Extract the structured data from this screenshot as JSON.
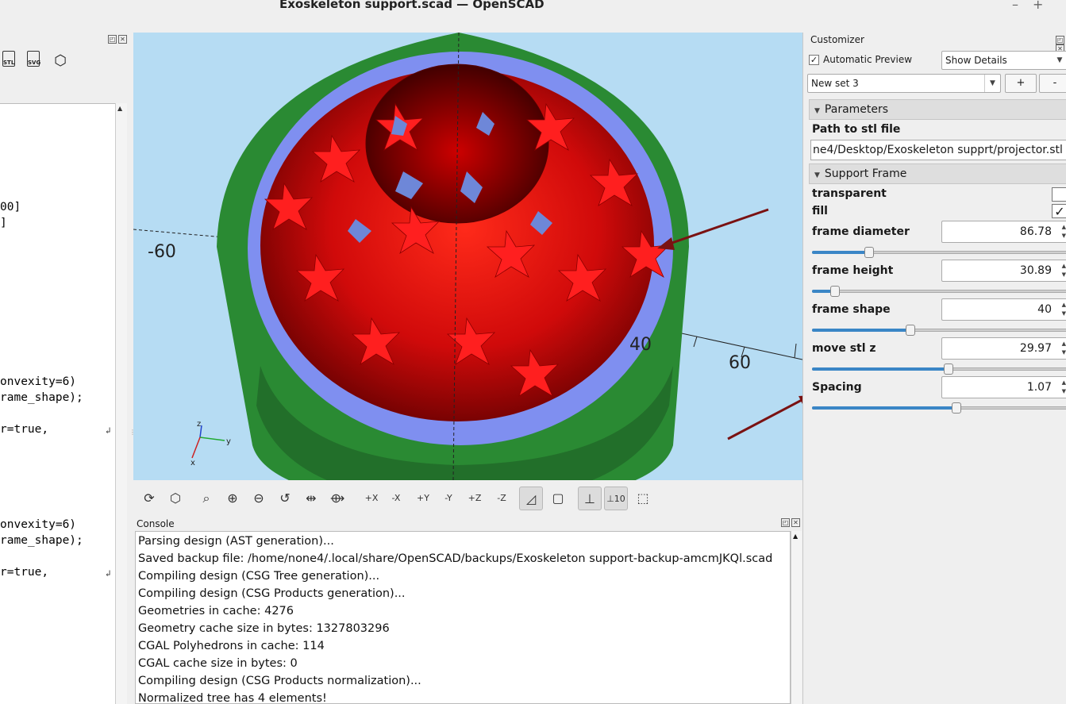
{
  "window": {
    "title": "Exoskeleton support.scad — OpenSCAD",
    "min_glyph": "–",
    "max_glyph": "+"
  },
  "editor": {
    "toolbar": [
      {
        "name": "export-stl-button",
        "label": "STL"
      },
      {
        "name": "export-svg-button",
        "label": "SVG"
      },
      {
        "name": "export-3d-button",
        "label": "⬡"
      }
    ],
    "lines": [
      {
        "text": "00]"
      },
      {
        "text": "]"
      },
      {
        "text": "onvexity=6)"
      },
      {
        "text": "rame_shape);"
      },
      {
        "text": "r=true,"
      },
      {
        "text": "onvexity=6)"
      },
      {
        "text": "rame_shape);"
      },
      {
        "text": "r=true,"
      }
    ],
    "wrap_glyph": "↲"
  },
  "viewport": {
    "axis_labels": [
      "-60",
      "40",
      "60"
    ],
    "gizmo_labels": {
      "z": "z",
      "y": "y",
      "x": "x"
    },
    "colors": {
      "background": "#b6dcf3",
      "frame_outer": "#2a8a33",
      "frame_inner": "#7f8ff0",
      "sphere": "#d70c0c",
      "arrow": "#7a1212"
    }
  },
  "view_toolbar": {
    "buttons": [
      {
        "name": "preview-button",
        "glyph": "⟳",
        "active": false
      },
      {
        "name": "render-button",
        "glyph": "⬡",
        "active": false
      },
      {
        "name": "view-all-button",
        "glyph": "⌕",
        "active": false
      },
      {
        "name": "zoom-in-button",
        "glyph": "⊕",
        "active": false
      },
      {
        "name": "zoom-out-button",
        "glyph": "⊖",
        "active": false
      },
      {
        "name": "reset-view-button",
        "glyph": "↺",
        "active": false
      },
      {
        "name": "fit-button",
        "glyph": "⇹",
        "active": false
      },
      {
        "name": "animate-button",
        "glyph": "⟴",
        "active": false
      },
      {
        "name": "view-right-button",
        "glyph": "+X",
        "active": false
      },
      {
        "name": "view-left-button",
        "glyph": "-X",
        "active": false
      },
      {
        "name": "view-back-button",
        "glyph": "+Y",
        "active": false
      },
      {
        "name": "view-front-button",
        "glyph": "-Y",
        "active": false
      },
      {
        "name": "view-top-button",
        "glyph": "+Z",
        "active": false
      },
      {
        "name": "view-bottom-button",
        "glyph": "-Z",
        "active": false
      },
      {
        "name": "perspective-button",
        "glyph": "◿",
        "active": true
      },
      {
        "name": "orthogonal-button",
        "glyph": "▢",
        "active": false
      },
      {
        "name": "show-axes-button",
        "glyph": "⊥",
        "active": true
      },
      {
        "name": "show-scale-button",
        "glyph": "⊥10",
        "active": true
      },
      {
        "name": "show-edges-button",
        "glyph": "⬚",
        "active": false
      }
    ]
  },
  "console": {
    "title": "Console",
    "lines": [
      "Parsing design (AST generation)...",
      "Saved backup file: /home/none4/.local/share/OpenSCAD/backups/Exoskeleton support-backup-amcmJKQl.scad",
      "Compiling design (CSG Tree generation)...",
      "Compiling design (CSG Products generation)...",
      "Geometries in cache: 4276",
      "Geometry cache size in bytes: 1327803296",
      "CGAL Polyhedrons in cache: 114",
      "CGAL cache size in bytes: 0",
      "Compiling design (CSG Products normalization)...",
      "Normalized tree has 4 elements!"
    ]
  },
  "customizer": {
    "title": "Customizer",
    "automatic_preview_label": "Automatic Preview",
    "automatic_preview_checked": true,
    "details_combo": "Show Details",
    "preset_combo": "New set 3",
    "add_preset": "+",
    "remove_preset": "-",
    "groups": {
      "parameters": "Parameters",
      "support_frame": "Support Frame"
    },
    "path_label": "Path to stl file",
    "path_value": "ne4/Desktop/Exoskeleton supprt/projector.stl",
    "transparent_label": "transparent",
    "transparent_checked": false,
    "fill_label": "fill",
    "fill_checked": true,
    "check_glyph": "✓",
    "sliders": [
      {
        "name": "frame-diameter",
        "label": "frame diameter",
        "value": "86.78",
        "level": 0.22
      },
      {
        "name": "frame-height",
        "label": "frame height",
        "value": "30.89",
        "level": 0.09
      },
      {
        "name": "frame-shape",
        "label": "frame shape",
        "value": "40",
        "level": 0.38
      },
      {
        "name": "move-stl-z",
        "label": "move stl z",
        "value": "29.97",
        "level": 0.53
      },
      {
        "name": "spacing",
        "label": "Spacing",
        "value": "1.07",
        "level": 0.56
      }
    ]
  }
}
